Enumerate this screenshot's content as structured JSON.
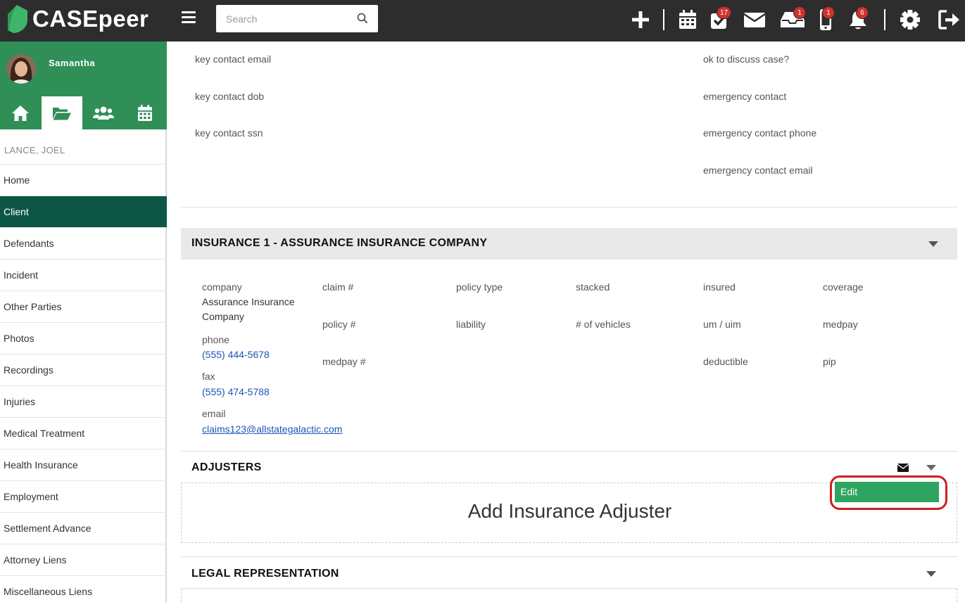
{
  "app": {
    "logo_text": "CASEpeer"
  },
  "search": {
    "placeholder": "Search"
  },
  "topbar": {
    "badges": {
      "tasks": "17",
      "inbox": "1",
      "phone": "1",
      "notifications": "6"
    }
  },
  "user": {
    "name": "Samantha"
  },
  "case": {
    "name": "LANCE, JOEL"
  },
  "sidebar": {
    "items": [
      {
        "label": "Home"
      },
      {
        "label": "Client"
      },
      {
        "label": "Defendants"
      },
      {
        "label": "Incident"
      },
      {
        "label": "Other Parties"
      },
      {
        "label": "Photos"
      },
      {
        "label": "Recordings"
      },
      {
        "label": "Injuries"
      },
      {
        "label": "Medical Treatment"
      },
      {
        "label": "Health Insurance"
      },
      {
        "label": "Employment"
      },
      {
        "label": "Settlement Advance"
      },
      {
        "label": "Attorney Liens"
      },
      {
        "label": "Miscellaneous Liens"
      }
    ]
  },
  "contact_fields": {
    "left": [
      "key contact email",
      "key contact dob",
      "key contact ssn"
    ],
    "right": [
      "ok to discuss case?",
      "emergency contact",
      "emergency contact phone",
      "emergency contact email"
    ]
  },
  "insurance": {
    "title": "INSURANCE 1 - ASSURANCE INSURANCE COMPANY",
    "company_label": "company",
    "company_value_line1": "Assurance Insurance",
    "company_value_line2": "Company",
    "phone_label": "phone",
    "phone_value": "(555) 444-5678",
    "fax_label": "fax",
    "fax_value": "(555) 474-5788",
    "email_label": "email",
    "email_value": "claims123@allstategalactic.com",
    "claim_label": "claim #",
    "policy_label": "policy #",
    "medpay_num_label": "medpay #",
    "policy_type_label": "policy type",
    "liability_label": "liability",
    "stacked_label": "stacked",
    "vehicles_label": "# of vehicles",
    "insured_label": "insured",
    "umuim_label": "um / uim",
    "deductible_label": "deductible",
    "coverage_label": "coverage",
    "medpay_label": "medpay",
    "pip_label": "pip"
  },
  "adjusters": {
    "title": "ADJUSTERS",
    "add_label": "Add Insurance Adjuster",
    "edit_label": "Edit"
  },
  "legal": {
    "title": "LEGAL REPRESENTATION"
  },
  "colors": {
    "brand_green": "#2f8f57",
    "active_nav": "#0d5645",
    "badge_red": "#d0312d",
    "edit_green": "#2fa460",
    "highlight": "#d01e1e"
  }
}
